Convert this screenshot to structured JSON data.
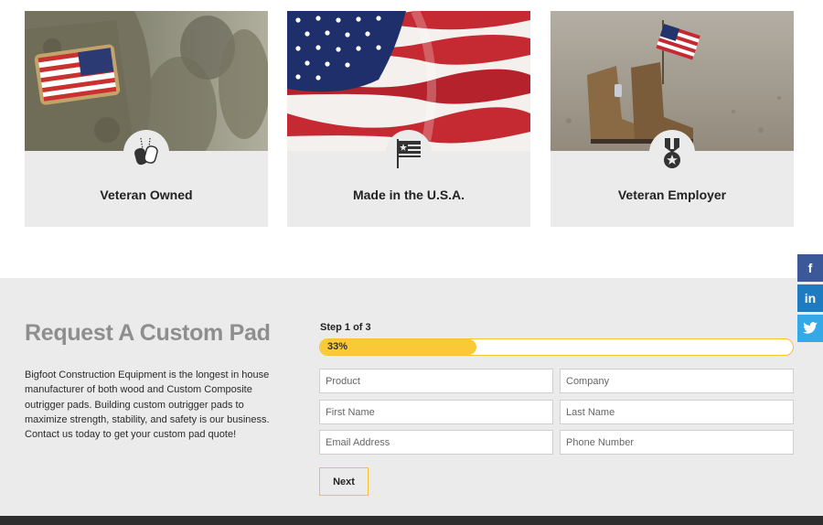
{
  "cards": [
    {
      "title": "Veteran Owned",
      "icon": "dog-tags-icon"
    },
    {
      "title": "Made in the U.S.A.",
      "icon": "flag-icon"
    },
    {
      "title": "Veteran Employer",
      "icon": "medal-icon"
    }
  ],
  "request": {
    "heading": "Request A Custom Pad",
    "description": "Bigfoot Construction Equipment is the longest in house manufacturer of both wood and Custom Composite outrigger pads. Building custom outrigger pads to maximize strength, stability, and safety is our business. Contact us today to get your custom pad quote!",
    "step_label": "Step 1 of 3",
    "progress_label": "33%",
    "progress_fraction": 0.33,
    "fields": {
      "product": "Product",
      "company": "Company",
      "first_name": "First Name",
      "last_name": "Last Name",
      "email": "Email Address",
      "phone": "Phone Number"
    },
    "next_label": "Next"
  },
  "social": {
    "facebook": "f",
    "linkedin": "in"
  },
  "colors": {
    "accent_yellow": "#f9c936",
    "section_bg": "#ebebeb",
    "heading_gray": "#8e8e8e",
    "facebook": "#3b5998",
    "linkedin": "#1e7bbf",
    "twitter": "#35a9e8"
  }
}
